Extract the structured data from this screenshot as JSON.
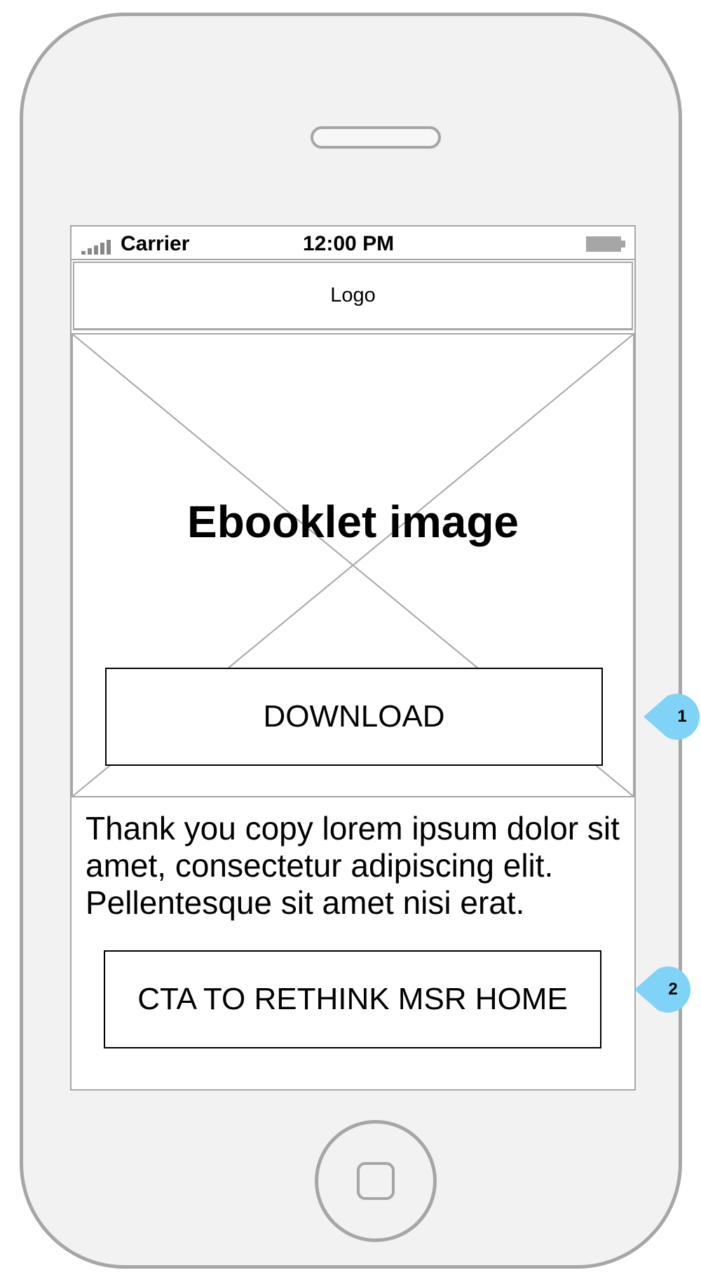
{
  "status_bar": {
    "carrier": "Carrier",
    "time": "12:00 PM"
  },
  "nav_bar": {
    "logo": "Logo"
  },
  "hero": {
    "image_label": "Ebooklet image",
    "download_label": "DOWNLOAD"
  },
  "body": {
    "thank_you_text": "Thank you copy lorem ipsum dolor sit amet, consectetur adipiscing elit. Pellentesque sit amet nisi erat."
  },
  "cta": {
    "label": "CTA TO RETHINK MSR HOME"
  },
  "callouts": [
    "1",
    "2"
  ],
  "colors": {
    "callout": "#7fd3f7",
    "wireframe_border": "#a6a6a6",
    "device_body": "#f2f2f2"
  }
}
